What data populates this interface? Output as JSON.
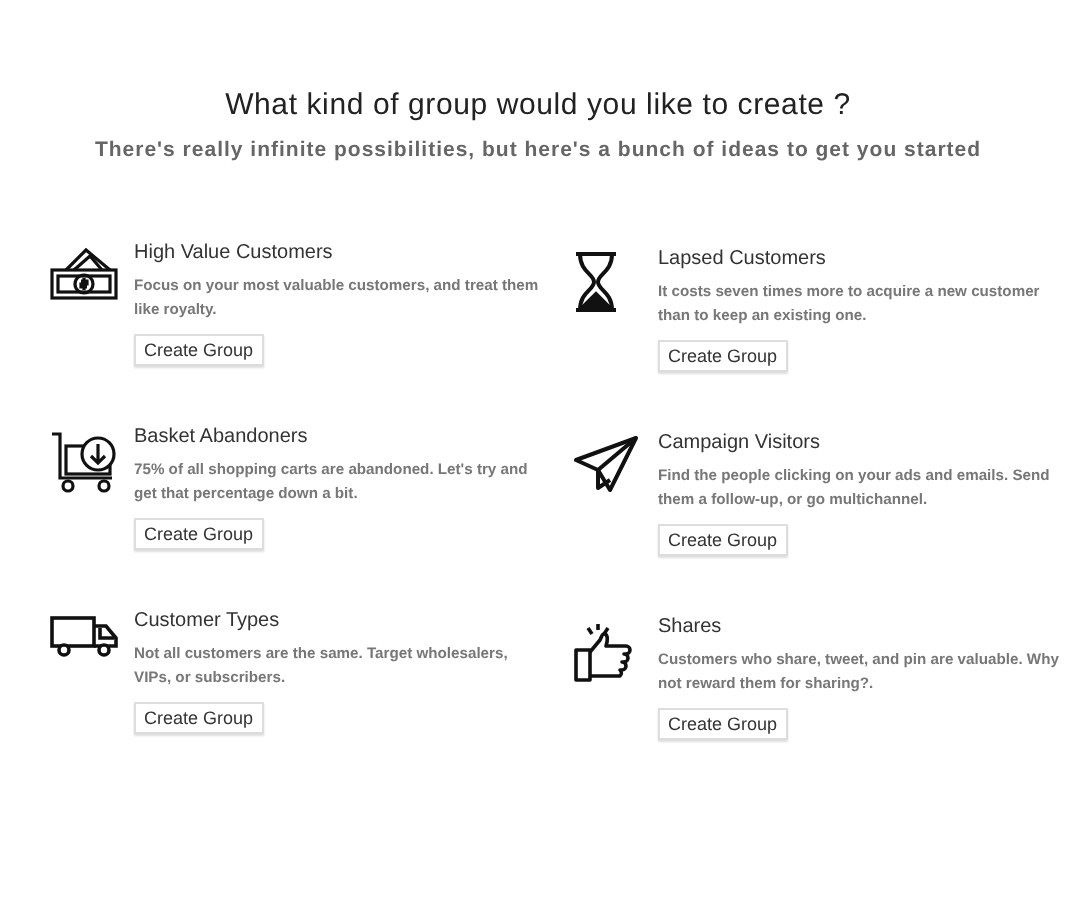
{
  "heading": "What kind of group would you like to create ?",
  "subheading": "There's really infinite possibilities, but here's a bunch of ideas to get you started",
  "groups": [
    {
      "kind": "money",
      "title": "High Value Customers",
      "description": "Focus on your most valuable customers, and treat them like royalty.",
      "button": "Create Group"
    },
    {
      "kind": "hourglass",
      "title": "Lapsed Customers",
      "description": "It costs seven times more to acquire a new customer than to keep an existing one.",
      "button": "Create Group"
    },
    {
      "kind": "cart",
      "title": "Basket Abandoners",
      "description": "75% of all shopping carts are abandoned. Let's try and get that percentage down a bit.",
      "button": "Create Group"
    },
    {
      "kind": "plane",
      "title": "Campaign Visitors",
      "description": "Find the people clicking on your ads and emails. Send them a follow-up, or go multichannel.",
      "button": "Create Group"
    },
    {
      "kind": "truck",
      "title": "Customer Types",
      "description": "Not all customers are the same. Target wholesalers, VIPs, or subscribers.",
      "button": "Create Group"
    },
    {
      "kind": "thumbs",
      "title": "Shares",
      "description": "Customers who share, tweet, and pin are valuable. Why not reward them for sharing?.",
      "button": "Create Group"
    }
  ]
}
